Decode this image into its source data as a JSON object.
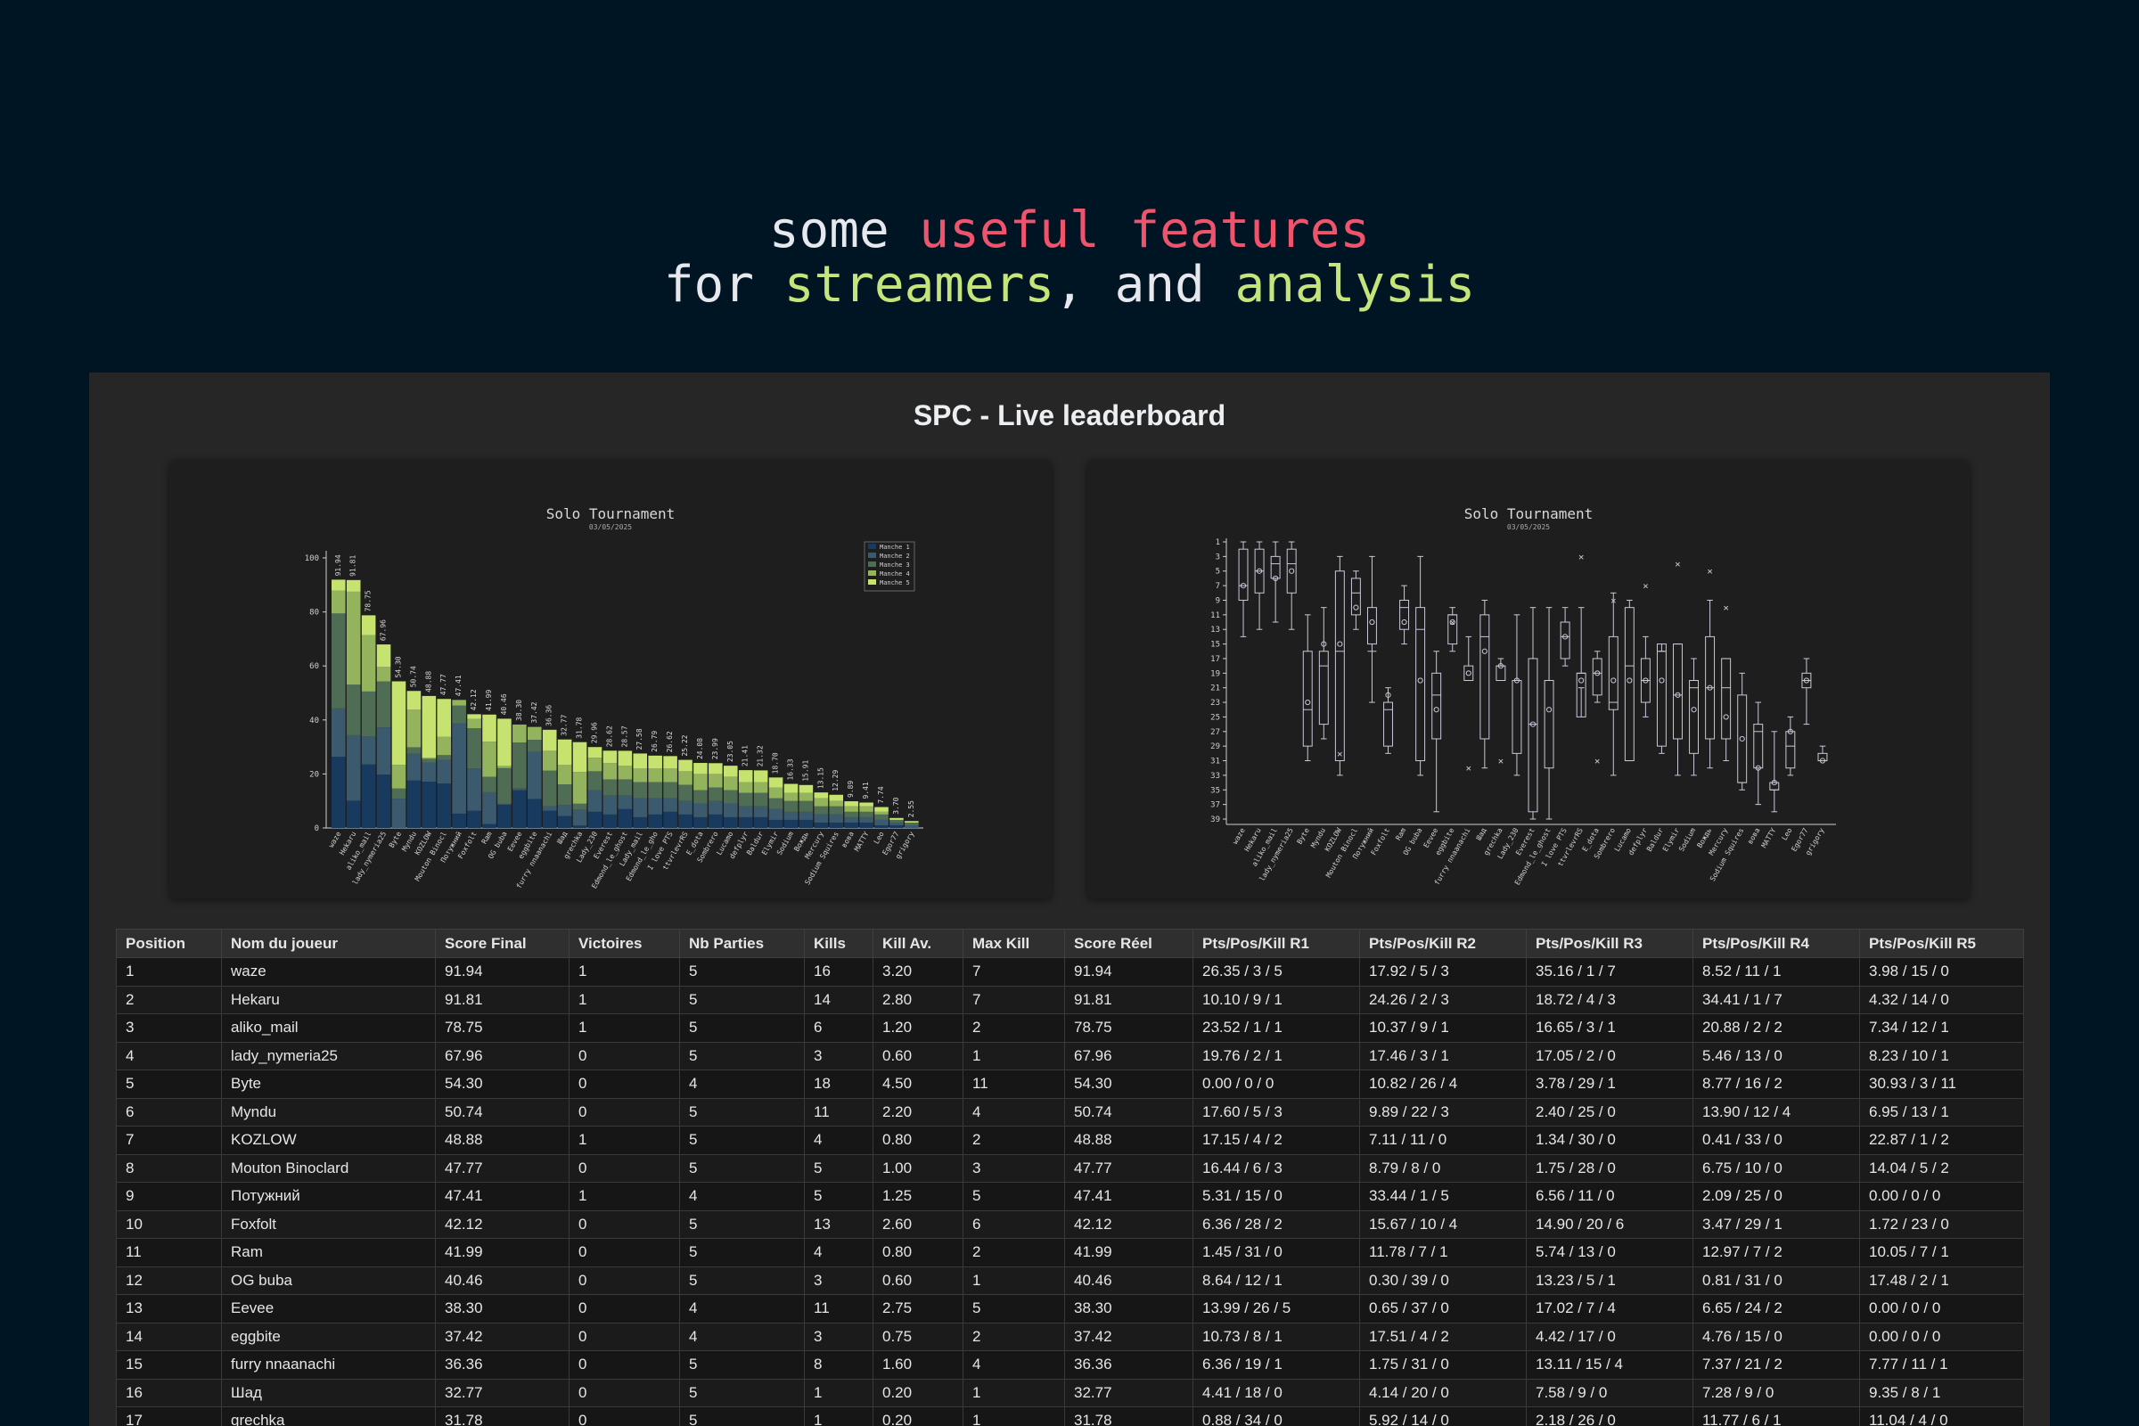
{
  "hero": {
    "line1": [
      {
        "text": "some ",
        "style": "plain"
      },
      {
        "text": "useful features",
        "style": "pink"
      }
    ],
    "line2": [
      {
        "text": "for ",
        "style": "plain"
      },
      {
        "text": "streamers",
        "style": "green"
      },
      {
        "text": ", and ",
        "style": "plain"
      },
      {
        "text": "analysis",
        "style": "green"
      }
    ]
  },
  "panel": {
    "title": "SPC - Live leaderboard"
  },
  "colors": {
    "page_bg": "#001524",
    "pink": "#f0546d",
    "green": "#c5e57a",
    "manche": [
      "#173a5e",
      "#3c5a6e",
      "#4f6d55",
      "#93b45c",
      "#c6e36f"
    ],
    "box": "#c8c8d8"
  },
  "chart_data": [
    {
      "type": "bar",
      "stacked": true,
      "title": "Solo Tournament",
      "subtitle": "03/05/2025",
      "ylim": [
        0,
        100
      ],
      "yticks": [
        0,
        20,
        40,
        60,
        80,
        100
      ],
      "legend_position": "top-right",
      "categories": [
        "waze",
        "Hekaru",
        "aliko_mail",
        "lady_nymeria25",
        "Byte",
        "Myndu",
        "KOZLOW",
        "Mouton Binocl",
        "Потужний",
        "Foxfolt",
        "Ram",
        "OG buba",
        "Eevee",
        "eggbite",
        "furry nnaanachi",
        "Шад",
        "grechka",
        "Lady_230",
        "Everest",
        "Edmond_le_ghost",
        "Lady_mail",
        "Edmond_le_gho",
        "I love PTS",
        "ttvrlevrRS",
        "E_dota",
        "Sombrero",
        "Lucamo",
        "defplyr",
        "Baldur",
        "Elymir",
        "Sodium",
        "Вождь",
        "Mercury",
        "Sodium Squires",
        "вова",
        "MATTY",
        "Leo",
        "Egor77",
        "grigory"
      ],
      "value_labels": [
        "91.94",
        "91.81",
        "78.75",
        "67.96",
        "54.30",
        "50.74",
        "48.88",
        "47.77",
        "47.41",
        "42.12",
        "41.99",
        "40.46",
        "38.30",
        "37.42",
        "36.36",
        "32.77",
        "31.78",
        "29.96",
        "28.62",
        "28.57",
        "27.58",
        "26.79",
        "26.62",
        "25.22",
        "24.08",
        "23.99",
        "23.05",
        "21.41",
        "21.32",
        "18.70",
        "16.33",
        "15.91",
        "13.15",
        "12.29",
        "9.89",
        "9.41",
        "7.74",
        "3.70",
        "2.55"
      ],
      "values": [
        91.94,
        91.81,
        78.75,
        67.96,
        54.3,
        50.74,
        48.88,
        47.77,
        47.41,
        42.12,
        41.99,
        40.46,
        38.3,
        37.42,
        36.36,
        32.77,
        31.78,
        29.96,
        28.62,
        28.57,
        27.58,
        26.79,
        26.62,
        25.22,
        24.08,
        23.99,
        23.05,
        21.41,
        21.32,
        18.7,
        16.33,
        15.91,
        13.15,
        12.29,
        9.89,
        9.41,
        7.74,
        3.7,
        2.55
      ],
      "series": [
        {
          "name": "Manche 1"
        },
        {
          "name": "Manche 2"
        },
        {
          "name": "Manche 3"
        },
        {
          "name": "Manche 4"
        },
        {
          "name": "Manche 5"
        }
      ],
      "split": [
        [
          26.35,
          17.92,
          35.16,
          8.52,
          3.98
        ],
        [
          10.1,
          24.26,
          18.72,
          34.41,
          4.32
        ],
        [
          23.52,
          10.37,
          16.65,
          20.88,
          7.34
        ],
        [
          19.76,
          17.46,
          17.05,
          5.46,
          8.23
        ],
        [
          0.0,
          10.82,
          3.78,
          8.77,
          30.93
        ],
        [
          17.6,
          9.89,
          2.4,
          13.9,
          6.95
        ],
        [
          17.15,
          7.11,
          1.34,
          0.41,
          22.87
        ],
        [
          16.44,
          8.79,
          1.75,
          6.75,
          14.04
        ],
        [
          5.31,
          33.44,
          6.56,
          2.09,
          0.0
        ],
        [
          6.36,
          15.67,
          14.9,
          3.47,
          1.72
        ],
        [
          1.45,
          11.78,
          5.74,
          12.97,
          10.05
        ],
        [
          8.64,
          0.3,
          13.23,
          0.81,
          17.48
        ],
        [
          13.99,
          0.65,
          17.02,
          6.65,
          0.0
        ],
        [
          10.73,
          17.51,
          4.42,
          4.76,
          0.0
        ],
        [
          6.36,
          1.75,
          13.11,
          7.37,
          7.77
        ],
        [
          4.41,
          4.14,
          7.58,
          7.28,
          9.35
        ],
        [
          0.88,
          5.92,
          2.18,
          11.77,
          11.04
        ],
        [
          6,
          8,
          7,
          5,
          3.96
        ],
        [
          5,
          7,
          6,
          6,
          4.62
        ],
        [
          7,
          5,
          6,
          5,
          5.57
        ],
        [
          4,
          7,
          6,
          5,
          5.58
        ],
        [
          5,
          6,
          6,
          5,
          4.79
        ],
        [
          6,
          5,
          6,
          5,
          4.62
        ],
        [
          5,
          5,
          6,
          5,
          4.22
        ],
        [
          4,
          5,
          5,
          6,
          4.08
        ],
        [
          5,
          5,
          5,
          5,
          3.99
        ],
        [
          4,
          5,
          5,
          5,
          4.05
        ],
        [
          4,
          4,
          5,
          4,
          4.41
        ],
        [
          4,
          4,
          5,
          4,
          4.32
        ],
        [
          3,
          4,
          4,
          4,
          3.7
        ],
        [
          3,
          3,
          4,
          3,
          3.33
        ],
        [
          3,
          3,
          4,
          3,
          2.91
        ],
        [
          2,
          3,
          3,
          3,
          2.15
        ],
        [
          2,
          3,
          3,
          2,
          2.29
        ],
        [
          2,
          2,
          2,
          2,
          1.89
        ],
        [
          2,
          2,
          2,
          2,
          1.41
        ],
        [
          1,
          2,
          2,
          1,
          1.74
        ],
        [
          1,
          1,
          1,
          0,
          0.7
        ],
        [
          0,
          1,
          1,
          0,
          0.55
        ]
      ]
    },
    {
      "type": "boxplot",
      "title": "Solo Tournament",
      "subtitle": "03/05/2025",
      "y_inverted": true,
      "ylim": [
        1,
        39
      ],
      "yticks": [
        1,
        3,
        5,
        7,
        9,
        11,
        13,
        15,
        17,
        19,
        21,
        23,
        25,
        27,
        29,
        31,
        33,
        35,
        37,
        39
      ],
      "categories": [
        "waze",
        "Hekaru",
        "aliko_mail",
        "lady_nymeria25",
        "Byte",
        "Myndu",
        "KOZLOW",
        "Mouton Binocl",
        "Потужний",
        "Foxfolt",
        "Ram",
        "OG buba",
        "Eevee",
        "eggbite",
        "furry nnaanachi",
        "Шад",
        "grechka",
        "Lady_230",
        "Everest",
        "Edmond_le_ghost",
        "I love PTS",
        "ttvrlevrRS",
        "E_dota",
        "Sombrero",
        "Lucamo",
        "defplyr",
        "Baldur",
        "Elymir",
        "Sodium",
        "Вождь",
        "Mercury",
        "Sodium Squires",
        "вова",
        "MATTY",
        "Leo",
        "Egor77",
        "grigory"
      ],
      "boxes": [
        [
          1,
          2,
          7,
          9,
          14
        ],
        [
          1,
          2,
          5,
          8,
          13
        ],
        [
          1,
          3,
          4,
          6,
          12
        ],
        [
          1,
          2,
          4,
          8,
          13
        ],
        [
          11,
          16,
          24,
          29,
          31
        ],
        [
          10,
          16,
          18,
          26,
          28
        ],
        [
          3,
          5,
          16,
          31,
          33
        ],
        [
          5,
          6,
          8,
          11,
          13
        ],
        [
          3,
          10,
          16,
          15,
          23
        ],
        [
          21,
          23,
          24,
          29,
          30
        ],
        [
          7,
          9,
          10,
          13,
          15
        ],
        [
          3,
          10,
          13,
          31,
          33
        ],
        [
          16,
          19,
          22,
          28,
          38
        ],
        [
          10,
          11,
          11,
          15,
          16
        ],
        [
          14,
          18,
          20,
          20,
          20
        ],
        [
          9,
          11,
          14,
          28,
          32
        ],
        [
          17,
          18,
          18,
          20,
          20
        ],
        [
          11,
          20,
          20,
          30,
          33
        ],
        [
          10,
          17,
          26,
          38,
          39
        ],
        [
          10,
          20,
          20,
          32,
          39
        ],
        [
          10,
          12,
          14,
          17,
          18
        ],
        [
          10,
          19,
          19,
          25,
          21
        ],
        [
          16,
          17,
          19,
          22,
          23
        ],
        [
          8,
          14,
          23,
          24,
          33
        ],
        [
          9,
          10,
          18,
          31,
          31
        ],
        [
          14,
          17,
          20,
          23,
          25
        ],
        [
          16,
          15,
          16,
          29,
          30
        ],
        [
          15,
          15,
          22,
          28,
          33
        ],
        [
          17,
          20,
          21,
          30,
          33
        ],
        [
          9,
          14,
          21,
          28,
          32
        ],
        [
          17,
          17,
          21,
          28,
          31
        ],
        [
          19,
          22,
          34,
          34,
          35
        ],
        [
          23,
          26,
          27,
          32,
          37
        ],
        [
          27,
          34,
          35,
          35,
          38
        ],
        [
          25,
          27,
          29,
          32,
          33
        ],
        [
          17,
          19,
          20,
          21,
          26
        ],
        [
          29,
          30,
          31,
          31,
          31
        ]
      ],
      "means": [
        7,
        5,
        6,
        5,
        23,
        15,
        15,
        10,
        12,
        22,
        12,
        20,
        24,
        12,
        19,
        16,
        18,
        20,
        26,
        24,
        14,
        20,
        19,
        20,
        20,
        20,
        20,
        22,
        24,
        21,
        25,
        28,
        32,
        34,
        27,
        20,
        31
      ],
      "outliers": [
        [
          6,
          30
        ],
        [
          13,
          12
        ],
        [
          14,
          32
        ],
        [
          16,
          31
        ],
        [
          21,
          3
        ],
        [
          22,
          31
        ],
        [
          23,
          9
        ],
        [
          25,
          7
        ],
        [
          27,
          4
        ],
        [
          29,
          5
        ],
        [
          30,
          10
        ]
      ]
    }
  ],
  "table": {
    "headers": [
      "Position",
      "Nom du joueur",
      "Score Final",
      "Victoires",
      "Nb Parties",
      "Kills",
      "Kill Av.",
      "Max Kill",
      "Score Réel",
      "Pts/Pos/Kill R1",
      "Pts/Pos/Kill R2",
      "Pts/Pos/Kill R3",
      "Pts/Pos/Kill R4",
      "Pts/Pos/Kill R5"
    ],
    "rows": [
      [
        "1",
        "waze",
        "91.94",
        "1",
        "5",
        "16",
        "3.20",
        "7",
        "91.94",
        "26.35 / 3 / 5",
        "17.92 / 5 / 3",
        "35.16 / 1 / 7",
        "8.52 / 11 / 1",
        "3.98 / 15 / 0"
      ],
      [
        "2",
        "Hekaru",
        "91.81",
        "1",
        "5",
        "14",
        "2.80",
        "7",
        "91.81",
        "10.10 / 9 / 1",
        "24.26 / 2 / 3",
        "18.72 / 4 / 3",
        "34.41 / 1 / 7",
        "4.32 / 14 / 0"
      ],
      [
        "3",
        "aliko_mail",
        "78.75",
        "1",
        "5",
        "6",
        "1.20",
        "2",
        "78.75",
        "23.52 / 1 / 1",
        "10.37 / 9 / 1",
        "16.65 / 3 / 1",
        "20.88 / 2 / 2",
        "7.34 / 12 / 1"
      ],
      [
        "4",
        "lady_nymeria25",
        "67.96",
        "0",
        "5",
        "3",
        "0.60",
        "1",
        "67.96",
        "19.76 / 2 / 1",
        "17.46 / 3 / 1",
        "17.05 / 2 / 0",
        "5.46 / 13 / 0",
        "8.23 / 10 / 1"
      ],
      [
        "5",
        "Byte",
        "54.30",
        "0",
        "4",
        "18",
        "4.50",
        "11",
        "54.30",
        "0.00 / 0 / 0",
        "10.82 / 26 / 4",
        "3.78 / 29 / 1",
        "8.77 / 16 / 2",
        "30.93 / 3 / 11"
      ],
      [
        "6",
        "Myndu",
        "50.74",
        "0",
        "5",
        "11",
        "2.20",
        "4",
        "50.74",
        "17.60 / 5 / 3",
        "9.89 / 22 / 3",
        "2.40 / 25 / 0",
        "13.90 / 12 / 4",
        "6.95 / 13 / 1"
      ],
      [
        "7",
        "KOZLOW",
        "48.88",
        "1",
        "5",
        "4",
        "0.80",
        "2",
        "48.88",
        "17.15 / 4 / 2",
        "7.11 / 11 / 0",
        "1.34 / 30 / 0",
        "0.41 / 33 / 0",
        "22.87 / 1 / 2"
      ],
      [
        "8",
        "Mouton Binoclard",
        "47.77",
        "0",
        "5",
        "5",
        "1.00",
        "3",
        "47.77",
        "16.44 / 6 / 3",
        "8.79 / 8 / 0",
        "1.75 / 28 / 0",
        "6.75 / 10 / 0",
        "14.04 / 5 / 2"
      ],
      [
        "9",
        "Потужний",
        "47.41",
        "1",
        "4",
        "5",
        "1.25",
        "5",
        "47.41",
        "5.31 / 15 / 0",
        "33.44 / 1 / 5",
        "6.56 / 11 / 0",
        "2.09 / 25 / 0",
        "0.00 / 0 / 0"
      ],
      [
        "10",
        "Foxfolt",
        "42.12",
        "0",
        "5",
        "13",
        "2.60",
        "6",
        "42.12",
        "6.36 / 28 / 2",
        "15.67 / 10 / 4",
        "14.90 / 20 / 6",
        "3.47 / 29 / 1",
        "1.72 / 23 / 0"
      ],
      [
        "11",
        "Ram",
        "41.99",
        "0",
        "5",
        "4",
        "0.80",
        "2",
        "41.99",
        "1.45 / 31 / 0",
        "11.78 / 7 / 1",
        "5.74 / 13 / 0",
        "12.97 / 7 / 2",
        "10.05 / 7 / 1"
      ],
      [
        "12",
        "OG buba",
        "40.46",
        "0",
        "5",
        "3",
        "0.60",
        "1",
        "40.46",
        "8.64 / 12 / 1",
        "0.30 / 39 / 0",
        "13.23 / 5 / 1",
        "0.81 / 31 / 0",
        "17.48 / 2 / 1"
      ],
      [
        "13",
        "Eevee",
        "38.30",
        "0",
        "4",
        "11",
        "2.75",
        "5",
        "38.30",
        "13.99 / 26 / 5",
        "0.65 / 37 / 0",
        "17.02 / 7 / 4",
        "6.65 / 24 / 2",
        "0.00 / 0 / 0"
      ],
      [
        "14",
        "eggbite",
        "37.42",
        "0",
        "4",
        "3",
        "0.75",
        "2",
        "37.42",
        "10.73 / 8 / 1",
        "17.51 / 4 / 2",
        "4.42 / 17 / 0",
        "4.76 / 15 / 0",
        "0.00 / 0 / 0"
      ],
      [
        "15",
        "furry nnaanachi",
        "36.36",
        "0",
        "5",
        "8",
        "1.60",
        "4",
        "36.36",
        "6.36 / 19 / 1",
        "1.75 / 31 / 0",
        "13.11 / 15 / 4",
        "7.37 / 21 / 2",
        "7.77 / 11 / 1"
      ],
      [
        "16",
        "Шад",
        "32.77",
        "0",
        "5",
        "1",
        "0.20",
        "1",
        "32.77",
        "4.41 / 18 / 0",
        "4.14 / 20 / 0",
        "7.58 / 9 / 0",
        "7.28 / 9 / 0",
        "9.35 / 8 / 1"
      ],
      [
        "17",
        "grechka",
        "31.78",
        "0",
        "5",
        "1",
        "0.20",
        "1",
        "31.78",
        "0.88 / 34 / 0",
        "5.92 / 14 / 0",
        "2.18 / 26 / 0",
        "11.77 / 6 / 1",
        "11.04 / 4 / 0"
      ]
    ]
  }
}
